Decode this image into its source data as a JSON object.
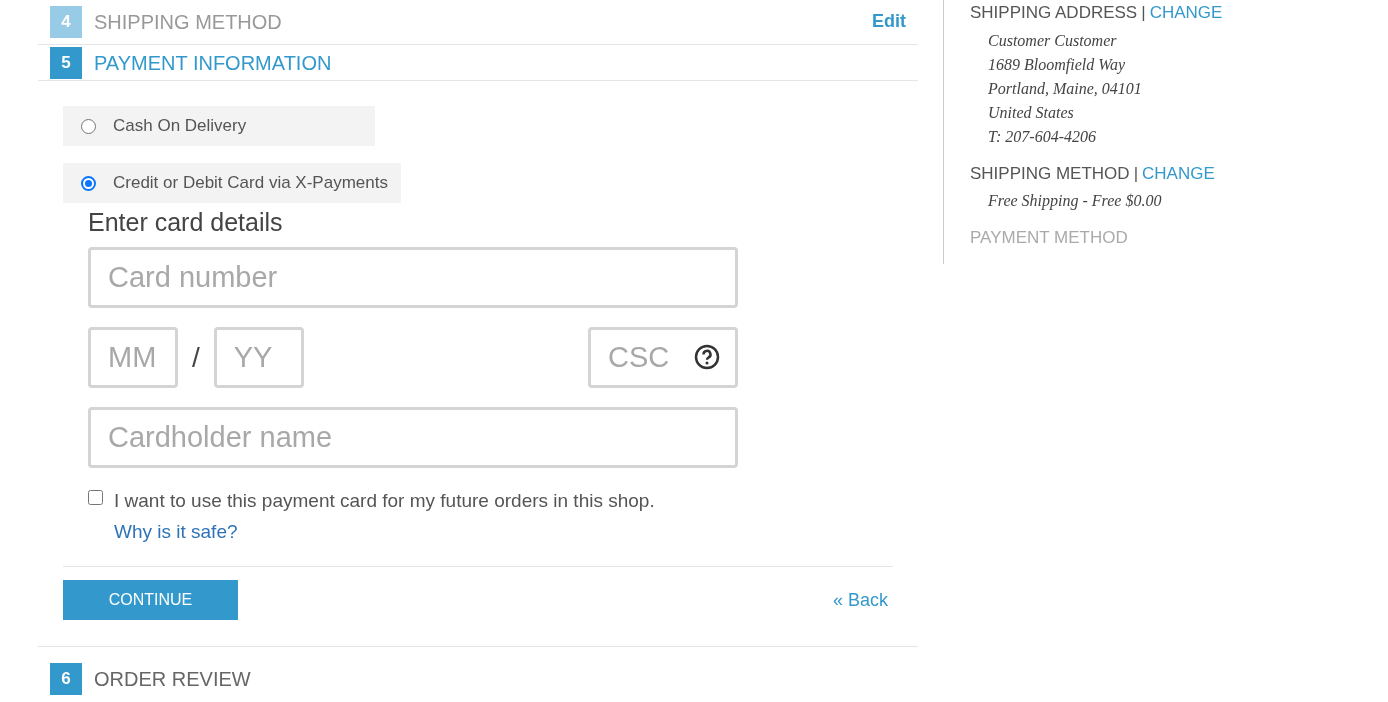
{
  "steps": [
    {
      "number": "4",
      "title": "SHIPPING METHOD",
      "completed": true,
      "selected": false,
      "edit_link": "Edit"
    },
    {
      "number": "5",
      "title": "PAYMENT INFORMATION",
      "completed": false,
      "selected": true
    },
    {
      "number": "6",
      "title": "ORDER REVIEW",
      "completed": false,
      "selected": false
    }
  ],
  "payment_options": [
    {
      "label": "Cash On Delivery",
      "selected": false
    },
    {
      "label": "Credit or Debit Card via X-Payments",
      "selected": true
    }
  ],
  "card_form": {
    "heading": "Enter card details",
    "card_number": {
      "placeholder": "Card number"
    },
    "month": {
      "placeholder": "MM"
    },
    "separator": "/",
    "year": {
      "placeholder": "YY"
    },
    "csc": {
      "placeholder": "CSC"
    },
    "cardholder": {
      "placeholder": "Cardholder name"
    },
    "save_card": {
      "label": "I want to use this payment card for my future orders in this shop.",
      "checked": false
    },
    "safe_link": "Why is it safe?"
  },
  "continue_button": "CONTINUE",
  "back_link": "« Back",
  "sidebar": {
    "sections": [
      {
        "title": "SHIPPING ADDRESS",
        "separator": "|",
        "change_link": "CHANGE",
        "lines": [
          "Customer Customer",
          "1689 Bloomfield Way",
          "Portland, Maine, 04101",
          "United States",
          "T: 207-604-4206"
        ]
      },
      {
        "title": "SHIPPING METHOD",
        "separator": "|",
        "change_link": "CHANGE",
        "lines": [
          "Free Shipping - Free $0.00"
        ]
      },
      {
        "title": "PAYMENT METHOD"
      }
    ]
  }
}
